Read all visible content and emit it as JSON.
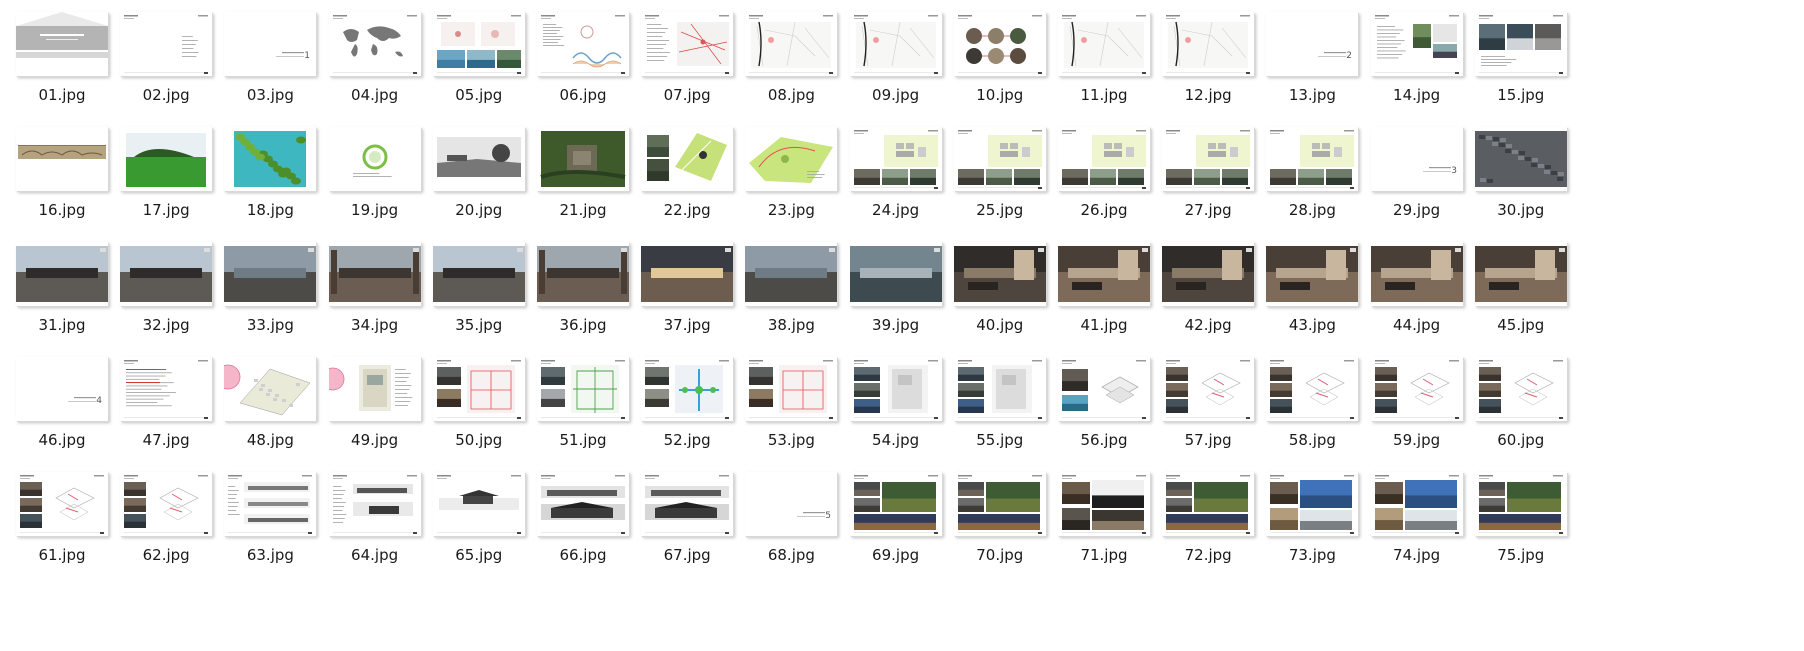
{
  "files": [
    {
      "name": "01.jpg",
      "kind": "cover"
    },
    {
      "name": "02.jpg",
      "kind": "text-right"
    },
    {
      "name": "03.jpg",
      "kind": "section",
      "num": "1"
    },
    {
      "name": "04.jpg",
      "kind": "worldmap"
    },
    {
      "name": "05.jpg",
      "kind": "map-photos"
    },
    {
      "name": "06.jpg",
      "kind": "infographic"
    },
    {
      "name": "07.jpg",
      "kind": "map-text"
    },
    {
      "name": "08.jpg",
      "kind": "map-light"
    },
    {
      "name": "09.jpg",
      "kind": "map-light"
    },
    {
      "name": "10.jpg",
      "kind": "circles"
    },
    {
      "name": "11.jpg",
      "kind": "map-light"
    },
    {
      "name": "12.jpg",
      "kind": "map-light"
    },
    {
      "name": "13.jpg",
      "kind": "section",
      "num": "2"
    },
    {
      "name": "14.jpg",
      "kind": "text-photos"
    },
    {
      "name": "15.jpg",
      "kind": "text-photos2"
    },
    {
      "name": "16.jpg",
      "kind": "scroll"
    },
    {
      "name": "17.jpg",
      "kind": "grass"
    },
    {
      "name": "18.jpg",
      "kind": "lotus"
    },
    {
      "name": "19.jpg",
      "kind": "ring"
    },
    {
      "name": "20.jpg",
      "kind": "bw-photo"
    },
    {
      "name": "21.jpg",
      "kind": "aerial-green"
    },
    {
      "name": "22.jpg",
      "kind": "plan-green"
    },
    {
      "name": "23.jpg",
      "kind": "plan-green2"
    },
    {
      "name": "24.jpg",
      "kind": "plan-photos"
    },
    {
      "name": "25.jpg",
      "kind": "plan-photos"
    },
    {
      "name": "26.jpg",
      "kind": "plan-photos"
    },
    {
      "name": "27.jpg",
      "kind": "plan-photos"
    },
    {
      "name": "28.jpg",
      "kind": "plan-photos"
    },
    {
      "name": "29.jpg",
      "kind": "section",
      "num": "3"
    },
    {
      "name": "30.jpg",
      "kind": "aerial-dark"
    },
    {
      "name": "31.jpg",
      "kind": "render-sky"
    },
    {
      "name": "32.jpg",
      "kind": "render-sky"
    },
    {
      "name": "33.jpg",
      "kind": "render-water"
    },
    {
      "name": "34.jpg",
      "kind": "render-court"
    },
    {
      "name": "35.jpg",
      "kind": "render-sky"
    },
    {
      "name": "36.jpg",
      "kind": "render-court"
    },
    {
      "name": "37.jpg",
      "kind": "render-night"
    },
    {
      "name": "38.jpg",
      "kind": "render-water"
    },
    {
      "name": "39.jpg",
      "kind": "render-mist"
    },
    {
      "name": "40.jpg",
      "kind": "interior-dark"
    },
    {
      "name": "41.jpg",
      "kind": "interior"
    },
    {
      "name": "42.jpg",
      "kind": "interior-dark"
    },
    {
      "name": "43.jpg",
      "kind": "interior"
    },
    {
      "name": "44.jpg",
      "kind": "interior"
    },
    {
      "name": "45.jpg",
      "kind": "interior"
    },
    {
      "name": "46.jpg",
      "kind": "section",
      "num": "4"
    },
    {
      "name": "47.jpg",
      "kind": "text-red"
    },
    {
      "name": "48.jpg",
      "kind": "plan-pink"
    },
    {
      "name": "49.jpg",
      "kind": "plan-pink2"
    },
    {
      "name": "50.jpg",
      "kind": "plan-red"
    },
    {
      "name": "51.jpg",
      "kind": "plan-green-lines"
    },
    {
      "name": "52.jpg",
      "kind": "plan-blue"
    },
    {
      "name": "53.jpg",
      "kind": "plan-red"
    },
    {
      "name": "54.jpg",
      "kind": "plan-photos-left"
    },
    {
      "name": "55.jpg",
      "kind": "plan-photos-left"
    },
    {
      "name": "56.jpg",
      "kind": "axo"
    },
    {
      "name": "57.jpg",
      "kind": "axo-photos"
    },
    {
      "name": "58.jpg",
      "kind": "axo-photos"
    },
    {
      "name": "59.jpg",
      "kind": "axo-photos"
    },
    {
      "name": "60.jpg",
      "kind": "axo-photos"
    },
    {
      "name": "61.jpg",
      "kind": "axo-photos"
    },
    {
      "name": "62.jpg",
      "kind": "axo-photos"
    },
    {
      "name": "63.jpg",
      "kind": "elevations"
    },
    {
      "name": "64.jpg",
      "kind": "elevations2"
    },
    {
      "name": "65.jpg",
      "kind": "elevation-one"
    },
    {
      "name": "66.jpg",
      "kind": "elevation-dark"
    },
    {
      "name": "67.jpg",
      "kind": "elevation-dark"
    },
    {
      "name": "68.jpg",
      "kind": "section",
      "num": "5"
    },
    {
      "name": "69.jpg",
      "kind": "collage"
    },
    {
      "name": "70.jpg",
      "kind": "collage"
    },
    {
      "name": "71.jpg",
      "kind": "collage-bw"
    },
    {
      "name": "72.jpg",
      "kind": "collage"
    },
    {
      "name": "73.jpg",
      "kind": "collage-blue"
    },
    {
      "name": "74.jpg",
      "kind": "collage-blue"
    },
    {
      "name": "75.jpg",
      "kind": "collage"
    }
  ]
}
